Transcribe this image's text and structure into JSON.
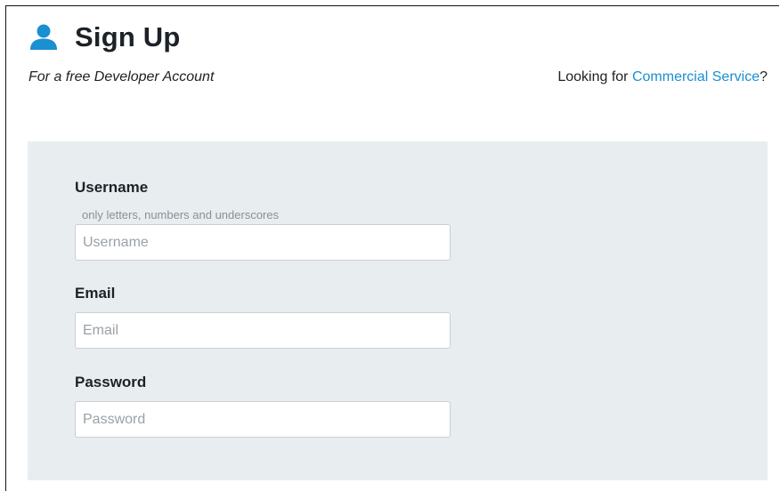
{
  "header": {
    "title": "Sign Up",
    "subtitle": "For a free Developer Account",
    "commercial_prefix": "Looking for ",
    "commercial_link": "Commercial Service",
    "commercial_suffix": "?",
    "icon": "user-icon"
  },
  "form": {
    "username": {
      "label": "Username",
      "hint": "only letters, numbers and underscores",
      "placeholder": "Username",
      "value": ""
    },
    "email": {
      "label": "Email",
      "placeholder": "Email",
      "value": ""
    },
    "password": {
      "label": "Password",
      "placeholder": "Password",
      "value": ""
    }
  },
  "colors": {
    "accent": "#1a8fd1",
    "panel_bg": "#e8edf0",
    "title": "#1c2227"
  }
}
